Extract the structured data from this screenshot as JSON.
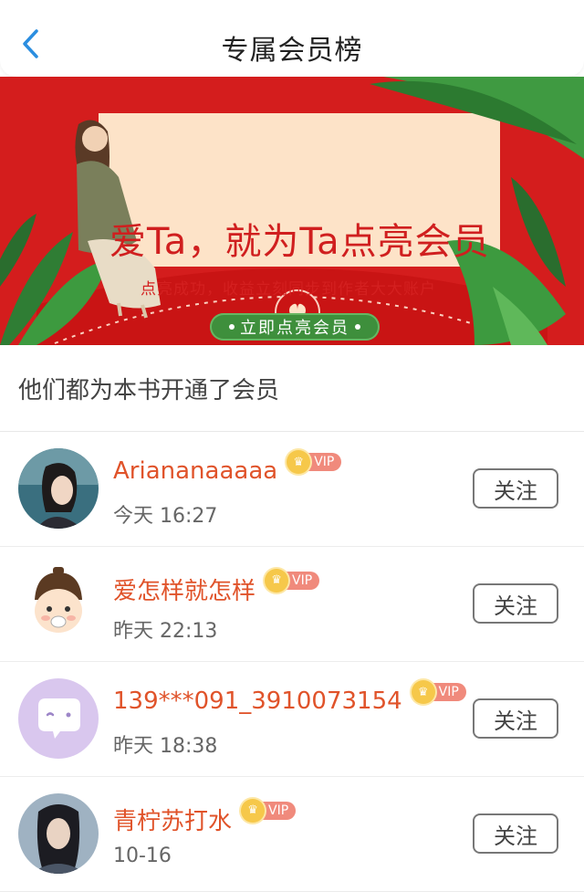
{
  "header": {
    "title": "专属会员榜"
  },
  "banner": {
    "headline": "爱Ta，就为Ta点亮会员",
    "subline": "点亮成功，收益立刻同步到作者大大账户",
    "button_label": "立即点亮会员"
  },
  "section": {
    "title": "他们都为本书开通了会员"
  },
  "vip_label": "VIP",
  "follow_label": "关注",
  "members": [
    {
      "name": "Ariananaaaaa",
      "time": "今天 16:27",
      "avatar": "girl-photo"
    },
    {
      "name": "爱怎样就怎样",
      "time": "昨天 22:13",
      "avatar": "cartoon-kid"
    },
    {
      "name": "139***091_3910073154",
      "time": "昨天 18:38",
      "avatar": "chat-bubble"
    },
    {
      "name": "青柠苏打水",
      "time": "10-16",
      "avatar": "man-photo"
    }
  ],
  "colors": {
    "accent_red": "#d41d1d",
    "name_orange": "#e0532a",
    "vip_gold": "#f6c84a",
    "button_green": "#3e8f3c"
  }
}
